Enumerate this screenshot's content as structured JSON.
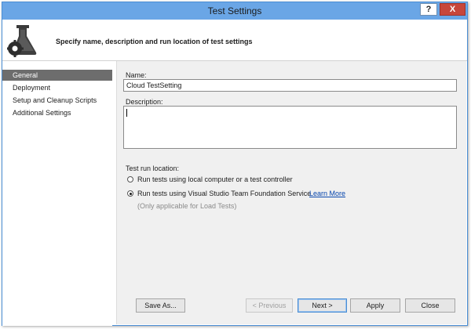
{
  "window": {
    "title": "Test Settings",
    "help_label": "?",
    "close_label": "X"
  },
  "header": {
    "icon": "flask-gear-icon",
    "text": "Specify name, description and run location of test settings"
  },
  "sidebar": {
    "items": [
      {
        "label": "General",
        "selected": true
      },
      {
        "label": "Deployment",
        "selected": false
      },
      {
        "label": "Setup and Cleanup Scripts",
        "selected": false
      },
      {
        "label": "Additional Settings",
        "selected": false
      }
    ]
  },
  "form": {
    "name_label": "Name:",
    "name_value": "Cloud TestSetting",
    "description_label": "Description:",
    "description_value": "",
    "run_location_label": "Test run location:",
    "options": [
      {
        "label": "Run tests using local computer or a test controller",
        "checked": false
      },
      {
        "label": "Run tests using Visual Studio Team Foundation Service",
        "checked": true
      }
    ],
    "learn_more": "Learn More",
    "note": "(Only applicable for Load Tests)"
  },
  "buttons": {
    "save_as": "Save As...",
    "previous": "< Previous",
    "next": "Next >",
    "apply": "Apply",
    "close": "Close"
  },
  "colors": {
    "titlebar": "#6aa6e6",
    "close_button": "#c7463b",
    "selected_item": "#6d6d6d",
    "content_bg": "#f0f0f0",
    "link": "#0645ad"
  }
}
